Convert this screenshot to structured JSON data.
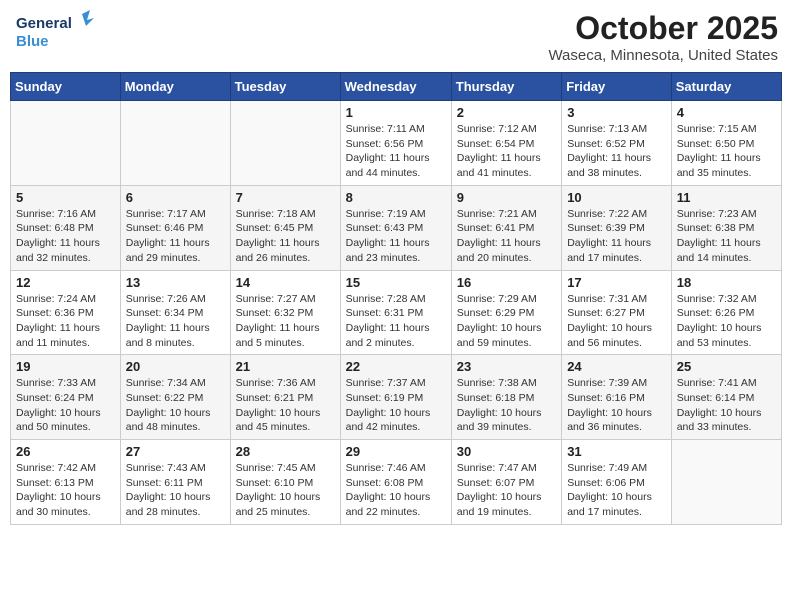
{
  "header": {
    "logo_general": "General",
    "logo_blue": "Blue",
    "title": "October 2025",
    "subtitle": "Waseca, Minnesota, United States"
  },
  "weekdays": [
    "Sunday",
    "Monday",
    "Tuesday",
    "Wednesday",
    "Thursday",
    "Friday",
    "Saturday"
  ],
  "weeks": [
    [
      {
        "day": "",
        "info": ""
      },
      {
        "day": "",
        "info": ""
      },
      {
        "day": "",
        "info": ""
      },
      {
        "day": "1",
        "info": "Sunrise: 7:11 AM\nSunset: 6:56 PM\nDaylight: 11 hours\nand 44 minutes."
      },
      {
        "day": "2",
        "info": "Sunrise: 7:12 AM\nSunset: 6:54 PM\nDaylight: 11 hours\nand 41 minutes."
      },
      {
        "day": "3",
        "info": "Sunrise: 7:13 AM\nSunset: 6:52 PM\nDaylight: 11 hours\nand 38 minutes."
      },
      {
        "day": "4",
        "info": "Sunrise: 7:15 AM\nSunset: 6:50 PM\nDaylight: 11 hours\nand 35 minutes."
      }
    ],
    [
      {
        "day": "5",
        "info": "Sunrise: 7:16 AM\nSunset: 6:48 PM\nDaylight: 11 hours\nand 32 minutes."
      },
      {
        "day": "6",
        "info": "Sunrise: 7:17 AM\nSunset: 6:46 PM\nDaylight: 11 hours\nand 29 minutes."
      },
      {
        "day": "7",
        "info": "Sunrise: 7:18 AM\nSunset: 6:45 PM\nDaylight: 11 hours\nand 26 minutes."
      },
      {
        "day": "8",
        "info": "Sunrise: 7:19 AM\nSunset: 6:43 PM\nDaylight: 11 hours\nand 23 minutes."
      },
      {
        "day": "9",
        "info": "Sunrise: 7:21 AM\nSunset: 6:41 PM\nDaylight: 11 hours\nand 20 minutes."
      },
      {
        "day": "10",
        "info": "Sunrise: 7:22 AM\nSunset: 6:39 PM\nDaylight: 11 hours\nand 17 minutes."
      },
      {
        "day": "11",
        "info": "Sunrise: 7:23 AM\nSunset: 6:38 PM\nDaylight: 11 hours\nand 14 minutes."
      }
    ],
    [
      {
        "day": "12",
        "info": "Sunrise: 7:24 AM\nSunset: 6:36 PM\nDaylight: 11 hours\nand 11 minutes."
      },
      {
        "day": "13",
        "info": "Sunrise: 7:26 AM\nSunset: 6:34 PM\nDaylight: 11 hours\nand 8 minutes."
      },
      {
        "day": "14",
        "info": "Sunrise: 7:27 AM\nSunset: 6:32 PM\nDaylight: 11 hours\nand 5 minutes."
      },
      {
        "day": "15",
        "info": "Sunrise: 7:28 AM\nSunset: 6:31 PM\nDaylight: 11 hours\nand 2 minutes."
      },
      {
        "day": "16",
        "info": "Sunrise: 7:29 AM\nSunset: 6:29 PM\nDaylight: 10 hours\nand 59 minutes."
      },
      {
        "day": "17",
        "info": "Sunrise: 7:31 AM\nSunset: 6:27 PM\nDaylight: 10 hours\nand 56 minutes."
      },
      {
        "day": "18",
        "info": "Sunrise: 7:32 AM\nSunset: 6:26 PM\nDaylight: 10 hours\nand 53 minutes."
      }
    ],
    [
      {
        "day": "19",
        "info": "Sunrise: 7:33 AM\nSunset: 6:24 PM\nDaylight: 10 hours\nand 50 minutes."
      },
      {
        "day": "20",
        "info": "Sunrise: 7:34 AM\nSunset: 6:22 PM\nDaylight: 10 hours\nand 48 minutes."
      },
      {
        "day": "21",
        "info": "Sunrise: 7:36 AM\nSunset: 6:21 PM\nDaylight: 10 hours\nand 45 minutes."
      },
      {
        "day": "22",
        "info": "Sunrise: 7:37 AM\nSunset: 6:19 PM\nDaylight: 10 hours\nand 42 minutes."
      },
      {
        "day": "23",
        "info": "Sunrise: 7:38 AM\nSunset: 6:18 PM\nDaylight: 10 hours\nand 39 minutes."
      },
      {
        "day": "24",
        "info": "Sunrise: 7:39 AM\nSunset: 6:16 PM\nDaylight: 10 hours\nand 36 minutes."
      },
      {
        "day": "25",
        "info": "Sunrise: 7:41 AM\nSunset: 6:14 PM\nDaylight: 10 hours\nand 33 minutes."
      }
    ],
    [
      {
        "day": "26",
        "info": "Sunrise: 7:42 AM\nSunset: 6:13 PM\nDaylight: 10 hours\nand 30 minutes."
      },
      {
        "day": "27",
        "info": "Sunrise: 7:43 AM\nSunset: 6:11 PM\nDaylight: 10 hours\nand 28 minutes."
      },
      {
        "day": "28",
        "info": "Sunrise: 7:45 AM\nSunset: 6:10 PM\nDaylight: 10 hours\nand 25 minutes."
      },
      {
        "day": "29",
        "info": "Sunrise: 7:46 AM\nSunset: 6:08 PM\nDaylight: 10 hours\nand 22 minutes."
      },
      {
        "day": "30",
        "info": "Sunrise: 7:47 AM\nSunset: 6:07 PM\nDaylight: 10 hours\nand 19 minutes."
      },
      {
        "day": "31",
        "info": "Sunrise: 7:49 AM\nSunset: 6:06 PM\nDaylight: 10 hours\nand 17 minutes."
      },
      {
        "day": "",
        "info": ""
      }
    ]
  ]
}
